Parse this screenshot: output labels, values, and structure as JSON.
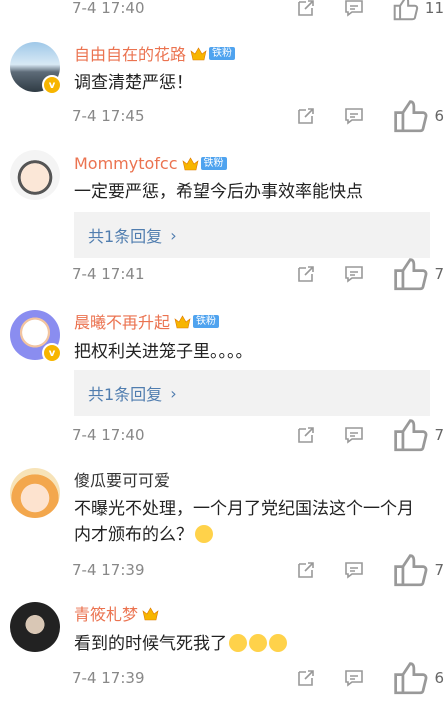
{
  "top_row": {
    "time": "7-4 17:40",
    "likes": "11"
  },
  "comments": [
    {
      "username": "自由自在的花路",
      "badge": "铁粉",
      "text": "调查清楚严惩！",
      "time": "7-4 17:45",
      "likes": "6"
    },
    {
      "username": "Mommytofcc",
      "badge": "铁粉",
      "text": "一定要严惩，希望今后办事效率能快点",
      "reply_label": "共1条回复",
      "time": "7-4 17:41",
      "likes": "7"
    },
    {
      "username": "晨曦不再升起",
      "badge": "铁粉",
      "text": "把权利关进笼子里。。。。",
      "reply_label": "共1条回复",
      "time": "7-4 17:40",
      "likes": "7"
    },
    {
      "username": "傻瓜要可可爱",
      "text": "不曝光不处理，一个月了党纪国法这个一个月内才颁布的么？",
      "time": "7-4 17:39",
      "likes": "7"
    },
    {
      "username": "青筱札梦",
      "text": "看到的时候气死我了",
      "time": "7-4 17:39",
      "likes": "6"
    }
  ],
  "icons": {
    "share": "share-icon",
    "comment": "comment-icon",
    "like": "thumbs-up-icon"
  },
  "colors": {
    "username": "#eb7350",
    "reply_link": "#507daf",
    "fan_badge": "#4fa3ef",
    "vip_crown": "#f7b500"
  }
}
